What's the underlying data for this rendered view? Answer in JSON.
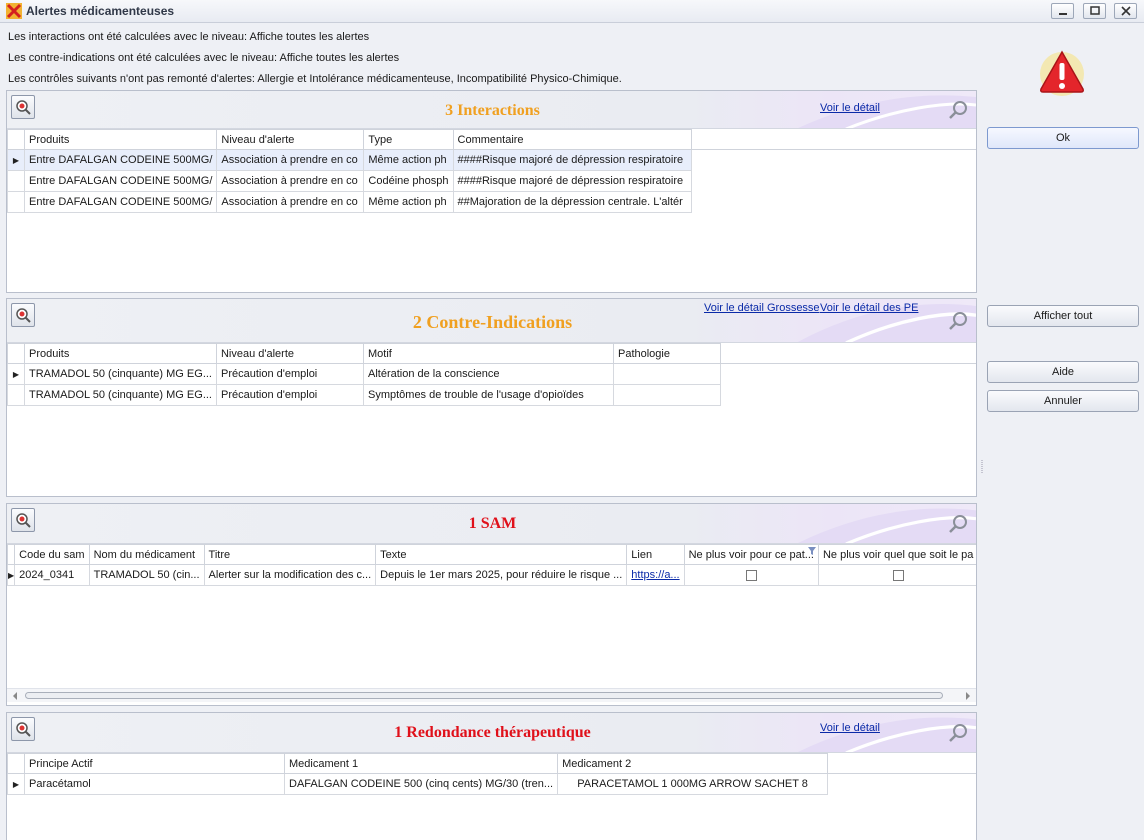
{
  "window": {
    "title": "Alertes médicamenteuses"
  },
  "info_lines": [
    "Les interactions ont été calculées avec le niveau: Affiche toutes les alertes",
    "Les contre-indications ont été calculées avec le niveau: Affiche toutes les alertes",
    "Les contrôles suivants n'ont pas remonté d'alertes: Allergie et Intolérance médicamenteuse, Incompatibilité Physico-Chimique."
  ],
  "colors": {
    "orange_title": "#f0a020",
    "red_title": "#e0101a",
    "link": "#0a2aa8"
  },
  "interactions": {
    "title": "3 Interactions",
    "link": "Voir le détail",
    "columns": [
      "Produits",
      "Niveau d'alerte",
      "Type",
      "Commentaire"
    ],
    "rows": [
      [
        "Entre DAFALGAN CODEINE 500MG/",
        "Association à prendre en co",
        "Même action ph",
        "####Risque majoré de dépression respiratoire"
      ],
      [
        "Entre DAFALGAN CODEINE 500MG/",
        "Association à prendre en co",
        "Codéine phosph",
        "####Risque majoré de dépression respiratoire"
      ],
      [
        "Entre DAFALGAN CODEINE 500MG/",
        "Association à prendre en co",
        "Même action ph",
        "##Majoration de la dépression centrale. L'altér"
      ]
    ]
  },
  "contre_indications": {
    "title": "2 Contre-Indications",
    "link_grossesse": "Voir le détail Grossesse",
    "link_pe": "Voir le détail des PE",
    "columns": [
      "Produits",
      "Niveau d'alerte",
      "Motif",
      "Pathologie"
    ],
    "rows": [
      [
        "TRAMADOL 50 (cinquante) MG EG...",
        "Précaution d'emploi",
        "Altération de la conscience",
        ""
      ],
      [
        "TRAMADOL 50 (cinquante) MG EG...",
        "Précaution d'emploi",
        "Symptômes de trouble de l'usage d'opioïdes",
        ""
      ]
    ]
  },
  "sam": {
    "title": "1 SAM",
    "columns": [
      "Code du sam",
      "Nom du médicament",
      "Titre",
      "Texte",
      "Lien",
      "Ne plus voir pour ce pat...",
      "Ne plus voir quel que soit le pa"
    ],
    "rows": [
      [
        "2024_0341",
        "TRAMADOL 50 (cin...",
        "Alerter sur la modification des c...",
        "Depuis le 1er mars 2025, pour réduire le risque ...",
        "https://a..."
      ]
    ],
    "checkbox_1": false,
    "checkbox_2": false
  },
  "redondance": {
    "title": "1 Redondance thérapeutique",
    "link": "Voir le détail",
    "columns": [
      "Principe Actif",
      "Medicament 1",
      "Medicament 2"
    ],
    "rows": [
      [
        "Paracétamol",
        "DAFALGAN CODEINE 500 (cinq cents) MG/30 (tren...",
        "PARACETAMOL 1 000MG ARROW SACHET 8"
      ]
    ]
  },
  "buttons": {
    "ok": "Ok",
    "afficher_tout": "Afficher tout",
    "aide": "Aide",
    "annuler": "Annuler"
  }
}
